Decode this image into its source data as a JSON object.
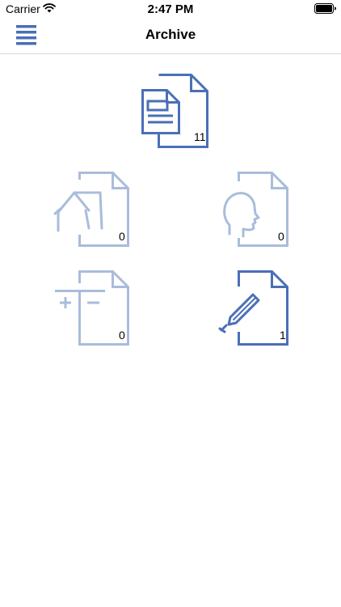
{
  "status_bar": {
    "carrier": "Carrier",
    "time": "2:47 PM",
    "wifi_icon": "wifi-icon",
    "battery_icon": "battery-icon"
  },
  "nav": {
    "title": "Archive",
    "menu_icon": "hamburger-menu-icon"
  },
  "documents": {
    "all": {
      "icon": "documents-stack-icon",
      "count": "11"
    },
    "home": {
      "icon": "house-document-icon",
      "count": "0"
    },
    "person": {
      "icon": "person-document-icon",
      "count": "0"
    },
    "finance": {
      "icon": "plus-minus-document-icon",
      "count": "0"
    },
    "notes": {
      "icon": "pencil-document-icon",
      "count": "1"
    }
  },
  "colors": {
    "accent": "#4a6fb5",
    "inactive": "#a9bcdc"
  }
}
